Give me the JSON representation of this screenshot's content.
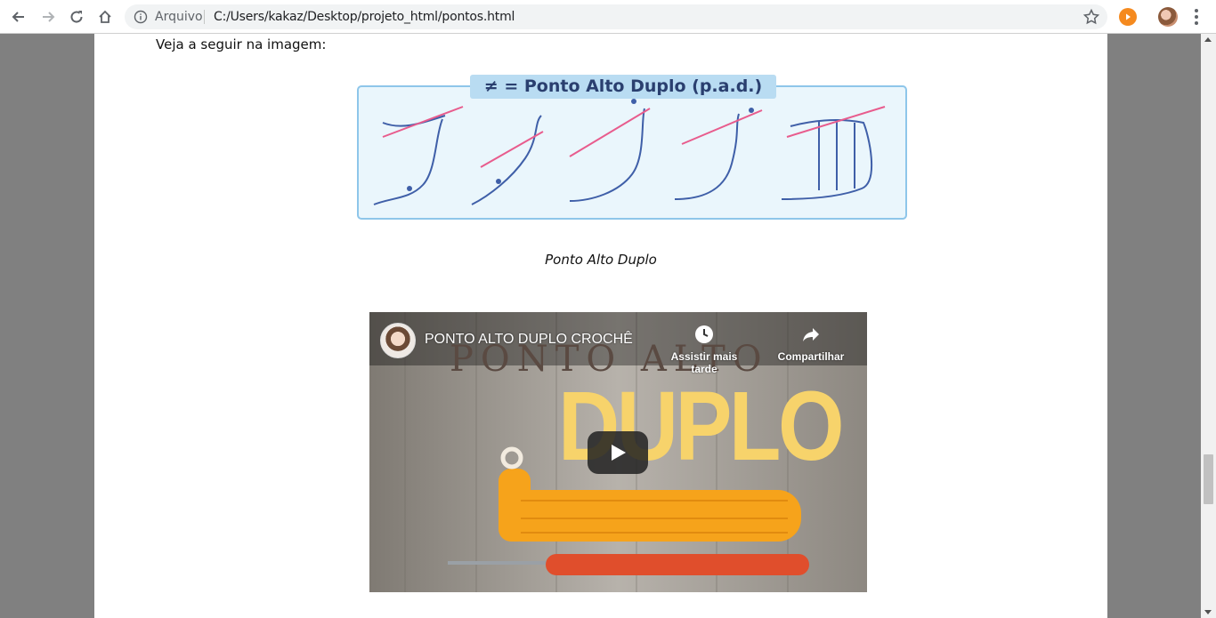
{
  "browser": {
    "scheme_label": "Arquivo",
    "url": "C:/Users/kakaz/Desktop/projeto_html/pontos.html",
    "icons": [
      "back-icon",
      "forward-icon",
      "reload-icon",
      "home-icon",
      "info-icon",
      "star-icon",
      "extension-icon",
      "avatar",
      "menu-icon"
    ]
  },
  "content": {
    "intro_text": "Veja a seguir na imagem:",
    "figure_title": "≠ = Ponto Alto Duplo (p.a.d.)",
    "caption": "Ponto Alto Duplo"
  },
  "video": {
    "title": "PONTO ALTO DUPLO CROCHÊ",
    "watch_later": "Assistir mais tarde",
    "share": "Compartilhar",
    "thumb_word_top": "PONTO ALTO",
    "thumb_word_big": "DUPLO"
  },
  "colors": {
    "figure_blue": "#3f5fa8",
    "figure_border": "#8ec6ea",
    "figure_title_bg": "#b9dcf2",
    "yarn_orange": "#f6a31b",
    "hook_red": "#e04e2c",
    "thumb_yellow": "#f7d36b"
  }
}
